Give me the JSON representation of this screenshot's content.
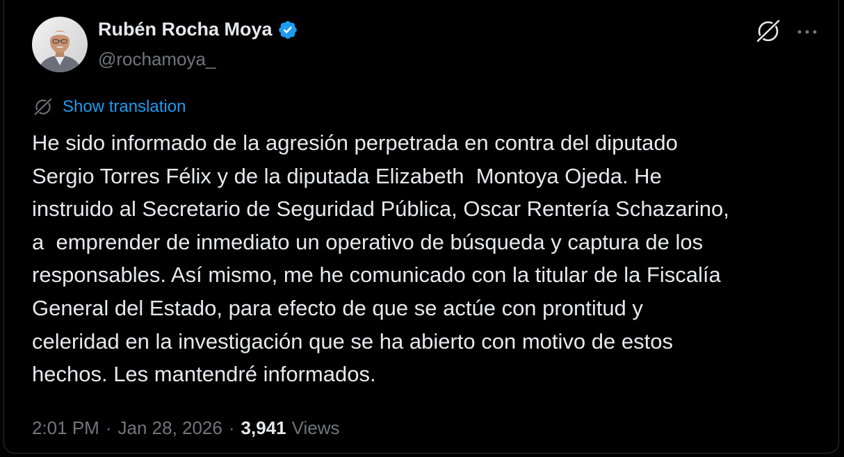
{
  "author": {
    "name": "Rubén Rocha Moya",
    "handle": "@rochamoya_",
    "verified": true,
    "avatar_icon": "profile-photo"
  },
  "actions": {
    "grok_icon": "grok-icon",
    "more_icon": "more-options-icon"
  },
  "translation": {
    "icon": "grok-icon",
    "label": "Show translation"
  },
  "tweet": {
    "text": "He sido informado de la agresión perpetrada en contra del diputado\nSergio Torres Félix y de la diputada Elizabeth  Montoya Ojeda. He\ninstruido al Secretario de Seguridad Pública, Oscar Rentería Schazarino,\na  emprender de inmediato un operativo de búsqueda y captura de los\nresponsables. Así mismo, me he comunicado con la titular de la Fiscalía\nGeneral del Estado, para efecto de que se actúe con prontitud y\nceleridad en la investigación que se ha abierto con motivo de estos\nhechos. Les mantendré informados."
  },
  "meta": {
    "time": "2:01 PM",
    "separator": "·",
    "date": "Jan 28, 2026",
    "views_count": "3,941",
    "views_label": "Views"
  },
  "colors": {
    "background": "#000000",
    "text_primary": "#e7e9ea",
    "text_secondary": "#71767b",
    "link": "#1d9bf0",
    "verified_badge": "#1d9bf0",
    "border": "#2f3336"
  }
}
